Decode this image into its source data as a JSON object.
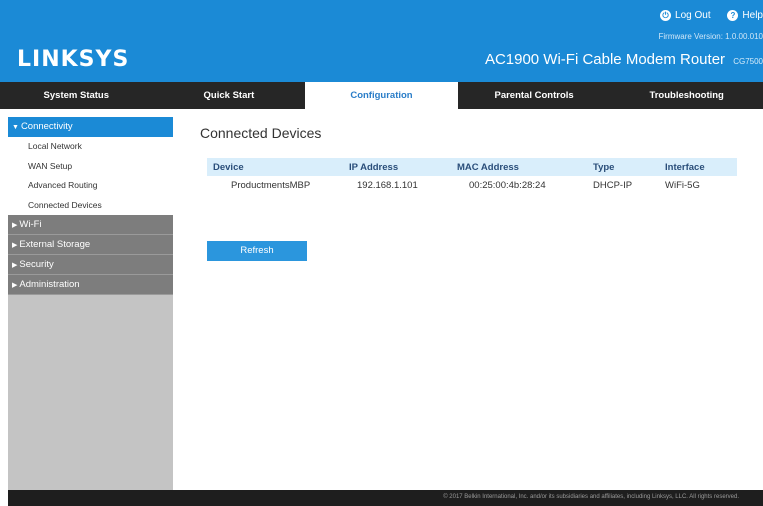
{
  "header": {
    "logo": "LINKSYS",
    "logout_label": "Log Out",
    "help_label": "Help",
    "firmware": "Firmware Version: 1.0.00.010",
    "product": "AC1900 Wi-Fi Cable Modem Router",
    "model": "CG7500"
  },
  "nav": {
    "tabs": [
      "System Status",
      "Quick Start",
      "Configuration",
      "Parental Controls",
      "Troubleshooting"
    ],
    "active": "Configuration"
  },
  "sidebar": {
    "connectivity": "Connectivity",
    "sub_items": [
      "Local Network",
      "WAN Setup",
      "Advanced Routing",
      "Connected Devices"
    ],
    "sections": [
      "Wi-Fi",
      "External Storage",
      "Security",
      "Administration"
    ]
  },
  "main": {
    "title": "Connected Devices",
    "table": {
      "headers": [
        "Device",
        "IP Address",
        "MAC Address",
        "Type",
        "Interface"
      ],
      "rows": [
        [
          "ProductmentsMBP",
          "192.168.1.101",
          "00:25:00:4b:28:24",
          "DHCP-IP",
          "WiFi-5G"
        ]
      ]
    },
    "refresh_label": "Refresh"
  },
  "footer": {
    "copyright": "© 2017 Belkin International, Inc. and/or its subsidiaries and affiliates, including Linksys, LLC. All rights reserved."
  },
  "colors": {
    "header_blue": "#1b8ad6",
    "nav_dark": "#262626",
    "sidebar_gray": "#c4c4c4",
    "sidebar_dark": "#7d7d7d",
    "table_header_bg": "#d9eefb",
    "button_blue": "#2b96dd"
  },
  "icons": {
    "logout": "power-icon",
    "help": "help-icon",
    "expand": "chevron-right-icon",
    "collapse": "chevron-down-icon"
  }
}
